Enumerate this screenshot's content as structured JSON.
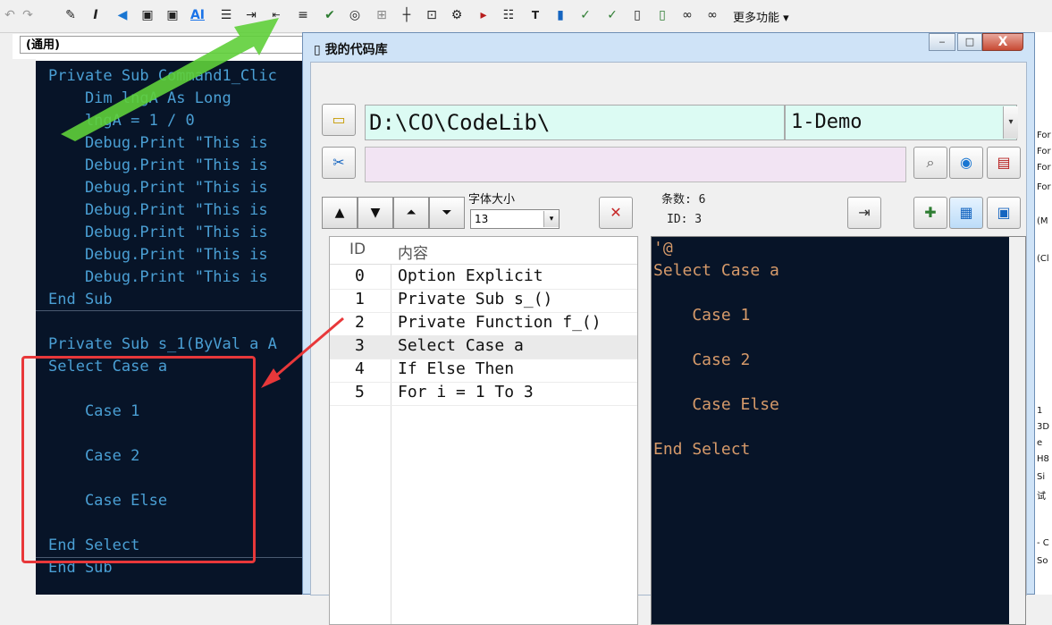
{
  "toolbar": {
    "more_label": "更多功能",
    "icons": [
      "undo-icon",
      "redo-icon",
      "pencil-icon",
      "italic-icon",
      "flag-icon",
      "save-icon",
      "save-all-icon",
      "ai-icon",
      "list-icon",
      "indent-icon",
      "outdent-icon",
      "comment-icon",
      "eye-icon",
      "grid-icon",
      "table-icon",
      "cross-icon",
      "settings-icon",
      "play-icon",
      "list2-icon",
      "tb-icon",
      "bookmark-icon",
      "check-icon",
      "check2-icon",
      "document-icon",
      "export-icon",
      "binoculars-icon",
      "binoculars2-icon"
    ]
  },
  "editor": {
    "combo_label": "(通用)",
    "lines": [
      "Private Sub Command1_Clic",
      "    Dim lngA As Long",
      "    lngA = 1 / 0",
      "    Debug.Print \"This is",
      "    Debug.Print \"This is",
      "    Debug.Print \"This is",
      "    Debug.Print \"This is",
      "    Debug.Print \"This is",
      "    Debug.Print \"This is",
      "    Debug.Print \"This is",
      "End Sub",
      "",
      "Private Sub s_1(ByVal a A",
      "Select Case a",
      "",
      "    Case 1",
      "",
      "    Case 2",
      "",
      "    Case Else",
      "",
      "End Select",
      "End Sub"
    ]
  },
  "right_panel": {
    "lines": [
      "For",
      "For",
      "For",
      "For",
      "(M",
      "(Cl",
      "1",
      "3D",
      "e",
      "H8",
      "Si",
      "试",
      "- C",
      "So"
    ]
  },
  "dialog": {
    "title": "我的代码库",
    "close_label": "X",
    "path": "D:\\CO\\CodeLib\\",
    "library": "1-Demo",
    "search_value": "",
    "font_size_label": "字体大小",
    "font_size_value": "13",
    "count_label": "条数: 6",
    "id_label": "ID: 3",
    "list_headers": {
      "id": "ID",
      "content": "内容"
    },
    "list_rows": [
      {
        "id": "0",
        "content": "Option Explicit"
      },
      {
        "id": "1",
        "content": "Private Sub s_()"
      },
      {
        "id": "2",
        "content": "Private Function f_()"
      },
      {
        "id": "3",
        "content": "Select Case a"
      },
      {
        "id": "4",
        "content": "If Else Then"
      },
      {
        "id": "5",
        "content": "For i = 1 To 3"
      }
    ],
    "selected_row_id": "3",
    "preview_lines": [
      "'@",
      "Select Case a",
      "",
      "    Case 1",
      "",
      "    Case 2",
      "",
      "    Case Else",
      "",
      "End Select"
    ]
  },
  "colors": {
    "code_bg": "#071428",
    "code_text": "#4a9fd4",
    "preview_text": "#d69a6a",
    "path_bg": "#dcfbf3",
    "search_bg": "#f2e4f3",
    "annotation": "#e8383a",
    "arrow_green": "#5fcf3a"
  }
}
